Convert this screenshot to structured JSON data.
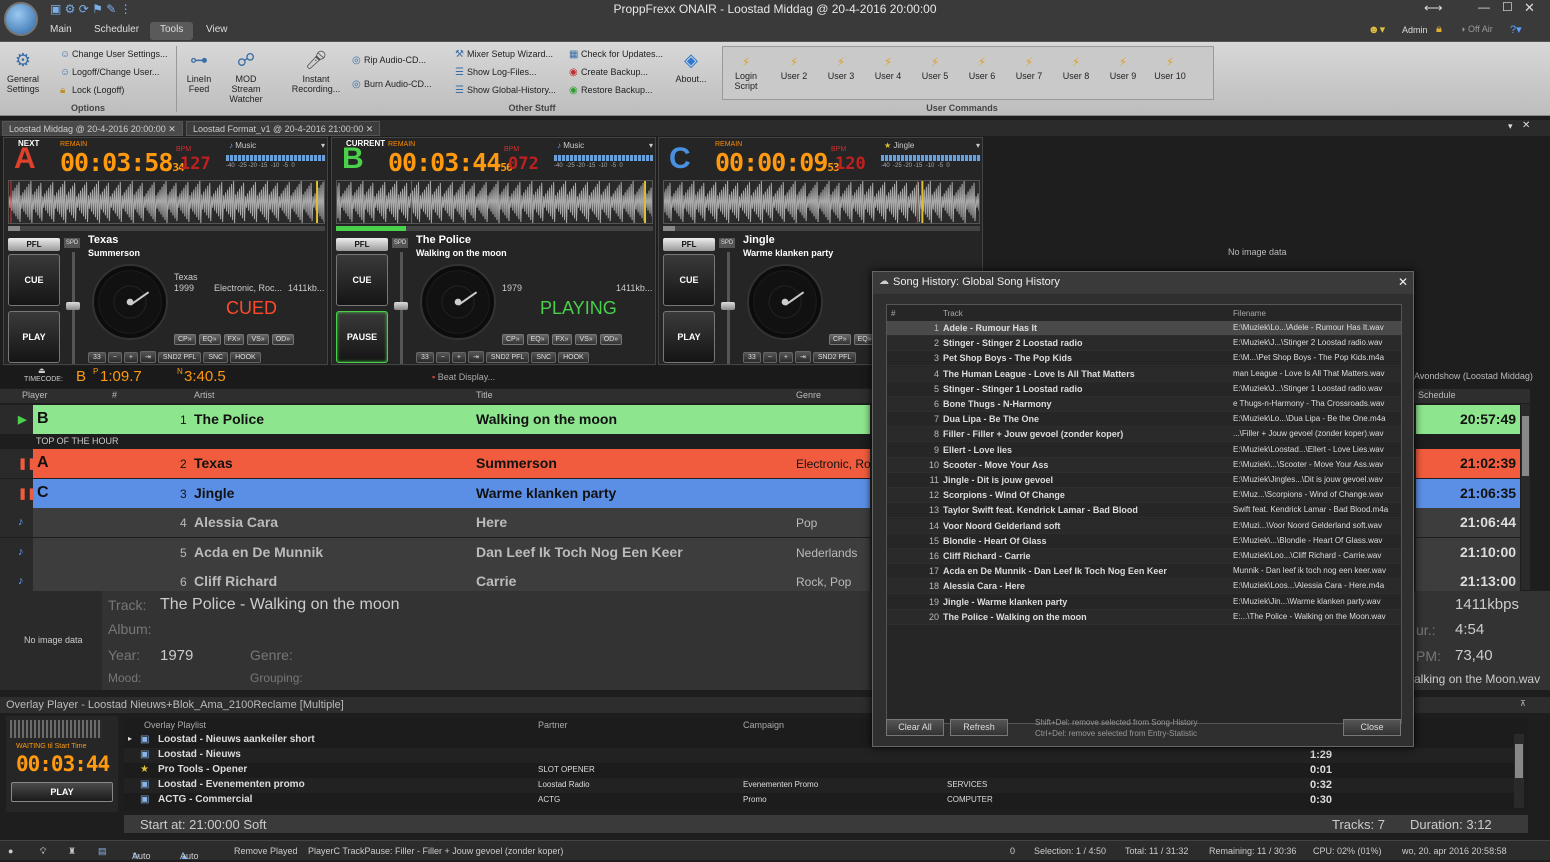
{
  "window": {
    "title": "ProppFrexx ONAIR - Loostad Middag @ 20-4-2016 20:00:00"
  },
  "menu": {
    "tabs": [
      "Main",
      "Scheduler",
      "Tools",
      "View"
    ],
    "active": "Tools"
  },
  "topright": {
    "user": "Admin",
    "onair": "Off Air"
  },
  "ribbon": {
    "general_settings": "General Settings",
    "options_items": [
      "Change User Settings...",
      "Logoff/Change User...",
      "Lock (Logoff)"
    ],
    "options_label": "Options",
    "linein": "LineIn Feed",
    "mod": "MOD Stream Watcher",
    "instant": "Instant Recording...",
    "rip": "Rip Audio-CD...",
    "burn": "Burn Audio-CD...",
    "other_items": [
      "Mixer Setup Wizard...",
      "Show Log-Files...",
      "Show Global-History..."
    ],
    "other2_items": [
      "Check for Updates...",
      "Create Backup...",
      "Restore Backup..."
    ],
    "about": "About...",
    "other_label": "Other Stuff",
    "user_commands": [
      "Login Script",
      "User 2",
      "User 3",
      "User 4",
      "User 5",
      "User 6",
      "User 7",
      "User 8",
      "User 9",
      "User 10"
    ],
    "user_label": "User Commands"
  },
  "doctabs": [
    "Loostad Middag @ 20-4-2016 20:00:00",
    "Loostad Format_v1 @ 20-4-2016 21:00:00"
  ],
  "decks": [
    {
      "letter": "A",
      "label": "NEXT",
      "remain": "00:03:58",
      "remain_ms": "34",
      "bpm": "127",
      "type": "Music",
      "artist": "Texas",
      "title": "Summerson",
      "info_artist": "Texas",
      "year": "1999",
      "genre": "Electronic, Roc...",
      "bitrate": "1411kb...",
      "state": "CUED",
      "btn1": "CUE",
      "btn2": "PLAY",
      "pfl": "PFL",
      "spd": "SPD",
      "nums": "33",
      "fx": [
        "CP»",
        "EQ»",
        "FX»",
        "VS»",
        "OD»"
      ],
      "bbtns": [
        "SND2 PFL",
        "SNC",
        "HOOK"
      ],
      "color": "#e0402a",
      "state_color": "#ff4a2a"
    },
    {
      "letter": "B",
      "label": "CURRENT",
      "remain": "00:03:44",
      "remain_ms": "56",
      "bpm": "072",
      "type": "Music",
      "artist": "The Police",
      "title": "Walking on the moon",
      "info_artist": "",
      "year": "1979",
      "genre": "",
      "bitrate": "1411kb...",
      "state": "PLAYING",
      "btn1": "CUE",
      "btn2": "PAUSE",
      "pfl": "PFL",
      "spd": "SPD",
      "nums": "33",
      "fx": [
        "CP»",
        "EQ»",
        "FX»",
        "VS»",
        "OD»"
      ],
      "bbtns": [
        "SND2 PFL",
        "SNC",
        "HOOK"
      ],
      "color": "#4ad04a",
      "state_color": "#4ad04a"
    },
    {
      "letter": "C",
      "label": "",
      "remain": "00:00:09",
      "remain_ms": "53",
      "bpm": "120",
      "type": "Jingle",
      "artist": "Jingle",
      "title": "Warme klanken party",
      "info_artist": "",
      "year": "",
      "genre": "",
      "bitrate": "",
      "state": "",
      "btn1": "CUE",
      "btn2": "PLAY",
      "pfl": "PFL",
      "spd": "SPD",
      "nums": "33",
      "fx": [
        "CP»",
        "EQ»"
      ],
      "bbtns": [
        "SND2 PFL"
      ],
      "color": "#4a90e0",
      "state_color": "#4a90e0"
    }
  ],
  "no_image": "No image data",
  "timecode": {
    "label": "TIMECODE:",
    "deck": "B",
    "pos": "1:09.7",
    "len": "3:40.5",
    "beat": "Beat Display..."
  },
  "playlist": {
    "headers": {
      "player": "Player",
      "num": "#",
      "artist": "Artist",
      "title": "Title",
      "genre": "Genre",
      "schedule": "Schedule"
    },
    "schedule_label": "Avondshow (Loostad Middag)",
    "top_of_hour": "TOP OF THE HOUR",
    "rows": [
      {
        "player": "B",
        "num": "1",
        "artist": "The Police",
        "title": "Walking on the moon",
        "genre": "",
        "time": "20:57:49",
        "bg": "#8de58d",
        "fg": "#111"
      },
      {
        "player": "A",
        "num": "2",
        "artist": "Texas",
        "title": "Summerson",
        "genre": "Electronic, Ro",
        "time": "21:02:39",
        "bg": "#f25c3e",
        "fg": "#111"
      },
      {
        "player": "C",
        "num": "3",
        "artist": "Jingle",
        "title": "Warme klanken party",
        "genre": "",
        "time": "21:06:35",
        "bg": "#5b8fe6",
        "fg": "#111"
      },
      {
        "player": "",
        "num": "4",
        "artist": "Alessia Cara",
        "title": "Here",
        "genre": "Pop",
        "time": "21:06:44",
        "bg": "#3d3d3d",
        "fg": "#bbb"
      },
      {
        "player": "",
        "num": "5",
        "artist": "Acda en De Munnik",
        "title": "Dan Leef Ik Toch Nog Een Keer",
        "genre": "Nederlands",
        "time": "21:10:00",
        "bg": "#3d3d3d",
        "fg": "#bbb"
      },
      {
        "player": "",
        "num": "6",
        "artist": "Cliff Richard",
        "title": "Carrie",
        "genre": "Rock, Pop",
        "time": "21:13:00",
        "bg": "#3d3d3d",
        "fg": "#bbb"
      }
    ]
  },
  "info": {
    "track_label": "Track:",
    "track": "The Police - Walking on the moon",
    "album_label": "Album:",
    "year_label": "Year:",
    "year": "1979",
    "genre_label": "Genre:",
    "mood_label": "Mood:",
    "grouping_label": "Grouping:",
    "bitrate": "1411kbps",
    "dur_label": "ur.:",
    "dur": "4:54",
    "bpm_label": "PM:",
    "bpm": "73,40",
    "file": "alking on the Moon.wav"
  },
  "overlay": {
    "title": "Overlay Player - Loostad Nieuws+Blok_Ama_2100Reclame [Multiple]",
    "waiting": "WAITING til Start Time",
    "timer": "00:03:44",
    "play": "PLAY",
    "headers": {
      "playlist": "Overlay Playlist",
      "partner": "Partner",
      "campaign": "Campaign"
    },
    "rows": [
      {
        "name": "Loostad - Nieuws aankeiler short",
        "partner": "",
        "campaign": "",
        "extra": "",
        "time": ""
      },
      {
        "name": "Loostad - Nieuws",
        "partner": "",
        "campaign": "",
        "extra": "",
        "time": "1:29"
      },
      {
        "name": "Pro Tools - Opener",
        "partner": "SLOT OPENER",
        "campaign": "",
        "extra": "",
        "time": "0:01"
      },
      {
        "name": "Loostad - Evenementen promo",
        "partner": "Loostad Radio",
        "campaign": "Evenementen Promo",
        "extra": "SERVICES",
        "time": "0:32"
      },
      {
        "name": "ACTG - Commercial",
        "partner": "ACTG",
        "campaign": "Promo",
        "extra": "COMPUTER",
        "time": "0:30"
      }
    ],
    "start": "Start at: 21:00:00  Soft",
    "tracks": "Tracks: 7",
    "duration": "Duration: 3:12"
  },
  "status": {
    "auto1": "Auto",
    "auto2": "Auto",
    "remove": "Remove Played",
    "msg": "PlayerC TrackPause: Filler - Filler + Jouw gevoel (zonder koper)",
    "zero": "0",
    "selection": "Selection: 1 / 4:50",
    "total": "Total: 11 / 31:32",
    "remaining": "Remaining: 11 / 30:36",
    "cpu": "CPU: 02% (01%)",
    "datetime": "wo, 20. apr 2016 20:58:58"
  },
  "history": {
    "title": "Song History: Global Song History",
    "headers": {
      "num": "#",
      "track": "Track",
      "filename": "Filename"
    },
    "rows": [
      {
        "n": "1",
        "track": "Adele - Rumour Has It",
        "file": "E:\\Muziek\\Lo...\\Adele - Rumour Has It.wav"
      },
      {
        "n": "2",
        "track": "Stinger - Stinger 2 Loostad radio",
        "file": "E:\\Muziek\\J...\\Stinger 2 Loostad radio.wav"
      },
      {
        "n": "3",
        "track": "Pet Shop Boys - The Pop Kids",
        "file": "E:\\M...\\Pet Shop Boys - The Pop Kids.m4a"
      },
      {
        "n": "4",
        "track": "The Human League - Love Is All That Matters",
        "file": "man League - Love Is All That Matters.wav"
      },
      {
        "n": "5",
        "track": "Stinger - Stinger 1 Loostad radio",
        "file": "E:\\Muziek\\J...\\Stinger 1 Loostad radio.wav"
      },
      {
        "n": "6",
        "track": "Bone Thugs - N-Harmony",
        "file": "e Thugs-n-Harmony - Tha Crossroads.wav"
      },
      {
        "n": "7",
        "track": "Dua Lipa - Be The One",
        "file": "E:\\Muziek\\Lo...\\Dua Lipa - Be the One.m4a"
      },
      {
        "n": "8",
        "track": "Filler - Filler + Jouw gevoel (zonder koper)",
        "file": "...\\Filler + Jouw gevoel (zonder koper).wav"
      },
      {
        "n": "9",
        "track": "Ellert - Love lies",
        "file": "E:\\Muziek\\Loostad...\\Ellert - Love Lies.wav"
      },
      {
        "n": "10",
        "track": "Scooter - Move Your Ass",
        "file": "E:\\Muziek\\...\\Scooter - Move Your Ass.wav"
      },
      {
        "n": "11",
        "track": "Jingle - Dit is jouw gevoel",
        "file": "E:\\Muziek\\Jingles...\\Dit is jouw gevoel.wav"
      },
      {
        "n": "12",
        "track": "Scorpions - Wind Of Change",
        "file": "E:\\Muz...\\Scorpions - Wind of Change.wav"
      },
      {
        "n": "13",
        "track": "Taylor Swift feat. Kendrick Lamar - Bad Blood",
        "file": "Swift feat. Kendrick Lamar - Bad Blood.m4a"
      },
      {
        "n": "14",
        "track": "Voor Noord Gelderland soft",
        "file": "E:\\Muzi...\\Voor Noord Gelderland soft.wav"
      },
      {
        "n": "15",
        "track": "Blondie - Heart Of Glass",
        "file": "E:\\Muziek\\...\\Blondie - Heart Of Glass.wav"
      },
      {
        "n": "16",
        "track": "Cliff Richard - Carrie",
        "file": "E:\\Muziek\\Loo...\\Cliff Richard - Carrie.wav"
      },
      {
        "n": "17",
        "track": "Acda en De Munnik - Dan Leef Ik Toch Nog Een Keer",
        "file": "Munnik - Dan leef ik toch nog een keer.wav"
      },
      {
        "n": "18",
        "track": "Alessia Cara - Here",
        "file": "E:\\Muziek\\Loos...\\Alessia Cara - Here.m4a"
      },
      {
        "n": "19",
        "track": "Jingle - Warme klanken party",
        "file": "E:\\Muziek\\Jin...\\Warme klanken party.wav"
      },
      {
        "n": "20",
        "track": "The Police - Walking on the moon",
        "file": "E:...\\The Police - Walking on the Moon.wav"
      }
    ],
    "clear": "Clear All",
    "refresh": "Refresh",
    "hint1": "Shift+Del: remove selected from Song-History",
    "hint2": "Ctrl+Del: remove selected from Entry-Statistic",
    "close": "Close"
  }
}
